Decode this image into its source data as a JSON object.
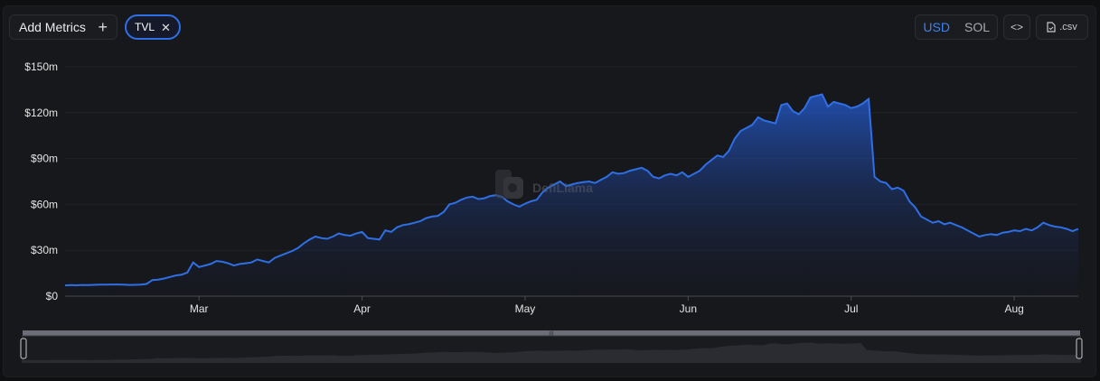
{
  "toolbar": {
    "add_metrics_label": "Add Metrics",
    "metric_chip_label": "TVL",
    "currency_options": [
      "USD",
      "SOL"
    ],
    "currency_selected": "USD",
    "embed_icon": "code-brackets-icon",
    "csv_label": ".csv",
    "csv_icon": "file-icon"
  },
  "watermark": {
    "text": "DefiLlama",
    "icon": "llama-logo"
  },
  "colors": {
    "accent": "#3b82f6",
    "line": "#2f6fe6",
    "background": "#17181b",
    "grid": "#24262b"
  },
  "chart_data": {
    "type": "area",
    "series": [
      {
        "values": [
          7,
          7.2,
          7.1,
          7.3,
          7.2,
          7.4,
          7.5,
          7.5,
          7.6,
          7.6,
          7.5,
          7.3,
          7.4,
          7.5,
          8,
          10.5,
          10.8,
          11.5,
          12.5,
          13.5,
          14,
          15.5,
          22,
          19,
          20,
          21,
          23,
          22.5,
          21.5,
          20,
          21,
          21.5,
          22,
          24,
          23,
          22,
          25,
          26.5,
          28,
          29.5,
          31.5,
          34.5,
          37,
          39,
          38,
          37.5,
          39,
          41,
          40,
          39.5,
          41,
          42,
          38,
          37.5,
          37,
          43,
          42,
          45,
          46.5,
          47,
          48,
          49,
          51,
          52,
          52.5,
          55,
          60,
          61,
          63,
          64.5,
          65,
          63.5,
          64,
          65.5,
          66,
          65,
          62,
          60,
          58.5,
          60.5,
          62,
          63,
          68,
          71,
          73,
          75,
          72,
          73,
          74,
          74.5,
          75,
          74,
          76,
          78,
          81,
          80,
          80.5,
          82,
          83,
          84,
          82,
          78,
          77,
          79,
          80,
          79,
          81,
          78,
          80,
          82,
          86,
          89,
          92,
          91,
          95,
          103,
          108,
          110,
          112,
          117,
          115,
          114,
          113,
          125,
          126,
          121,
          119,
          123,
          130,
          131,
          132,
          124,
          127,
          126,
          125,
          123,
          124,
          126,
          129,
          78,
          75,
          74,
          70,
          71,
          69,
          62,
          58,
          52,
          50,
          48,
          49,
          47,
          48,
          46.5,
          45,
          43,
          41,
          39,
          40,
          40.5,
          40,
          41.5,
          42,
          43,
          42.5,
          44,
          43,
          45,
          48,
          46.5,
          45.5,
          45,
          44,
          42.5,
          44
        ]
      }
    ],
    "value_unit": "$m",
    "x_ticks": [
      "Mar",
      "Apr",
      "May",
      "Jun",
      "Jul",
      "Aug"
    ],
    "x_tick_index": [
      23,
      51,
      79,
      107,
      135,
      163
    ],
    "y_ticks": [
      "$0",
      "$30m",
      "$60m",
      "$90m",
      "$120m",
      "$150m"
    ],
    "ylim": [
      0,
      150
    ],
    "grid": "horizontal",
    "legend": "none"
  }
}
